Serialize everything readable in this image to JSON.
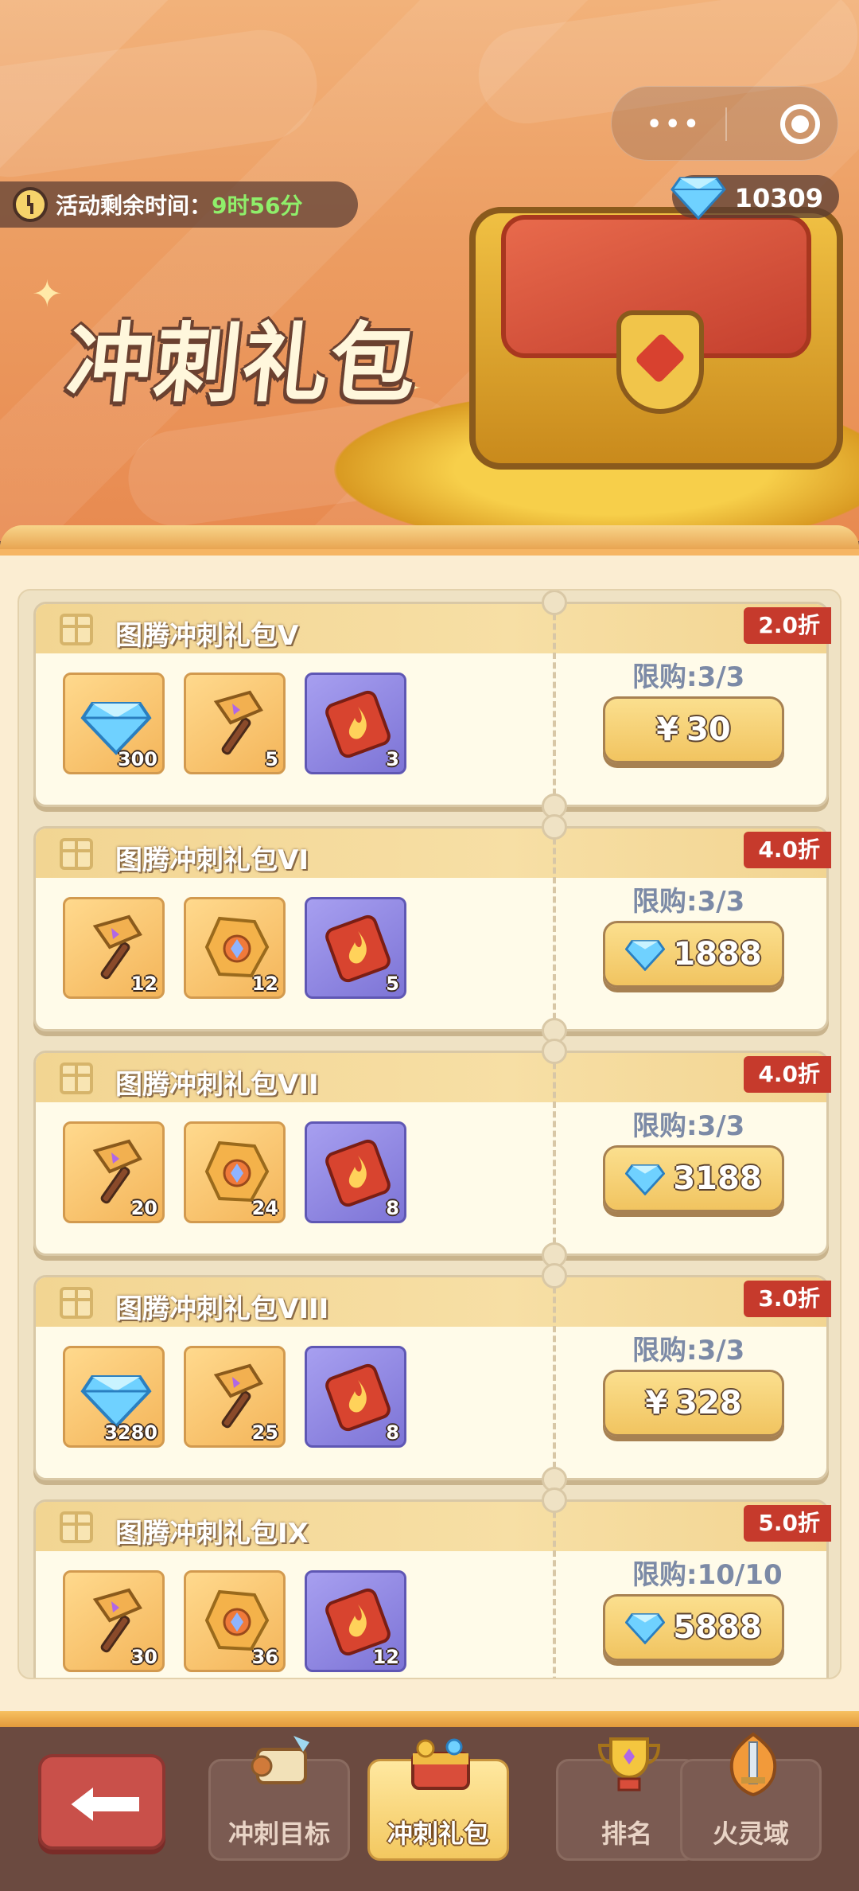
{
  "header": {
    "capsule_dots": "•••",
    "timer_label": "活动剩余时间：",
    "timer_value": "9时56分",
    "gem_count": "10309",
    "title": "冲刺礼包"
  },
  "colors": {
    "banner": "#ec9d62",
    "discount": "#c63a2c",
    "timer_value": "#8fef6a",
    "limit_text": "#7c8aa6"
  },
  "packs": [
    {
      "name": "图腾冲刺礼包V",
      "discount": "2.0折",
      "limit": "限购:3/3",
      "price_type": "cash",
      "price_symbol": "¥",
      "price": "30",
      "items": [
        {
          "icon": "diamond-icon",
          "qty": "300",
          "style": "gold"
        },
        {
          "icon": "hammer-icon",
          "qty": "5",
          "style": "gold"
        },
        {
          "icon": "fire-ticket-icon",
          "qty": "3",
          "style": "purple"
        }
      ]
    },
    {
      "name": "图腾冲刺礼包VI",
      "discount": "4.0折",
      "limit": "限购:3/3",
      "price_type": "gem",
      "price": "1888",
      "items": [
        {
          "icon": "hammer-icon",
          "qty": "12",
          "style": "gold"
        },
        {
          "icon": "ore-icon",
          "qty": "12",
          "style": "gold"
        },
        {
          "icon": "fire-ticket-icon",
          "qty": "5",
          "style": "purple"
        }
      ]
    },
    {
      "name": "图腾冲刺礼包VII",
      "discount": "4.0折",
      "limit": "限购:3/3",
      "price_type": "gem",
      "price": "3188",
      "items": [
        {
          "icon": "hammer-icon",
          "qty": "20",
          "style": "gold"
        },
        {
          "icon": "ore-icon",
          "qty": "24",
          "style": "gold"
        },
        {
          "icon": "fire-ticket-icon",
          "qty": "8",
          "style": "purple"
        }
      ]
    },
    {
      "name": "图腾冲刺礼包VIII",
      "discount": "3.0折",
      "limit": "限购:3/3",
      "price_type": "cash",
      "price_symbol": "¥",
      "price": "328",
      "items": [
        {
          "icon": "diamond-icon",
          "qty": "3280",
          "style": "gold"
        },
        {
          "icon": "hammer-icon",
          "qty": "25",
          "style": "gold"
        },
        {
          "icon": "fire-ticket-icon",
          "qty": "8",
          "style": "purple"
        }
      ]
    },
    {
      "name": "图腾冲刺礼包IX",
      "discount": "5.0折",
      "limit": "限购:10/10",
      "price_type": "gem",
      "price": "5888",
      "items": [
        {
          "icon": "hammer-icon",
          "qty": "30",
          "style": "gold"
        },
        {
          "icon": "ore-icon",
          "qty": "36",
          "style": "gold"
        },
        {
          "icon": "fire-ticket-icon",
          "qty": "12",
          "style": "purple"
        }
      ]
    }
  ],
  "nav": {
    "back_icon": "back-arrow-icon",
    "tabs": [
      {
        "label": "冲刺目标",
        "icon": "scroll-icon",
        "active": false
      },
      {
        "label": "冲刺礼包",
        "icon": "treasure-chest-icon",
        "active": true
      },
      {
        "label": "排名",
        "icon": "trophy-icon",
        "active": false
      },
      {
        "label": "火灵域",
        "icon": "sword-crest-icon",
        "active": false
      }
    ]
  }
}
